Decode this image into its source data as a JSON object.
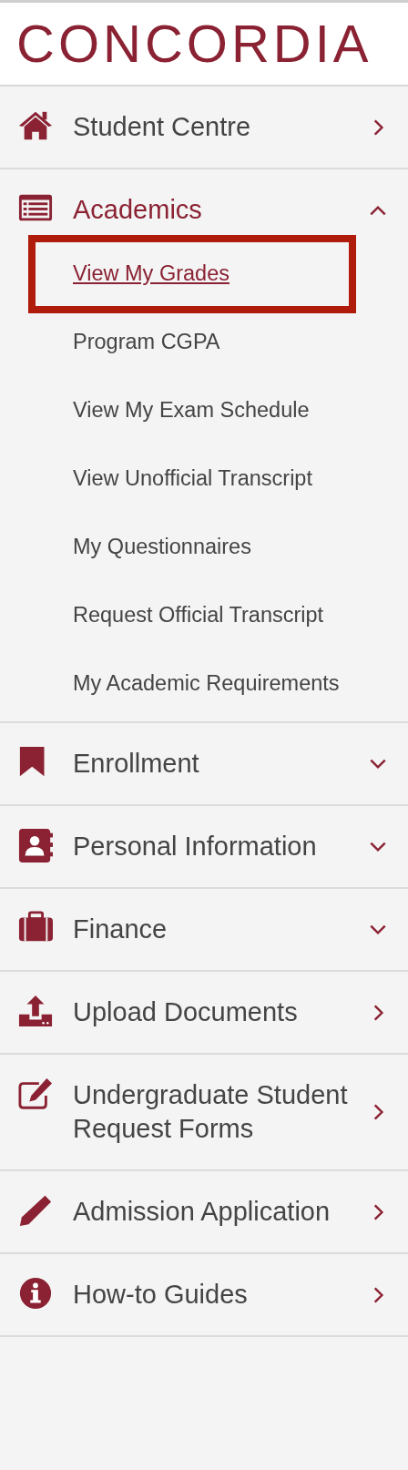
{
  "logo": {
    "text": "CONCORDIA"
  },
  "menu": [
    {
      "label": "Student Centre",
      "kind": "link"
    },
    {
      "label": "Academics",
      "kind": "group",
      "expanded": true,
      "children": [
        {
          "label": "View My Grades",
          "selected": true,
          "highlighted": true
        },
        {
          "label": "Program CGPA",
          "selected": false,
          "highlighted": false
        },
        {
          "label": "View My Exam Schedule",
          "selected": false,
          "highlighted": false
        },
        {
          "label": "View Unofficial Transcript",
          "selected": false,
          "highlighted": false
        },
        {
          "label": "My Questionnaires",
          "selected": false,
          "highlighted": false
        },
        {
          "label": "Request Official Transcript",
          "selected": false,
          "highlighted": false
        },
        {
          "label": "My Academic Requirements",
          "selected": false,
          "highlighted": false
        }
      ]
    },
    {
      "label": "Enrollment",
      "kind": "group",
      "expanded": false
    },
    {
      "label": "Personal Information",
      "kind": "group",
      "expanded": false
    },
    {
      "label": "Finance",
      "kind": "group",
      "expanded": false
    },
    {
      "label": "Upload Documents",
      "kind": "link"
    },
    {
      "label": "Undergraduate Student Request Forms",
      "kind": "link"
    },
    {
      "label": "Admission Application",
      "kind": "link"
    },
    {
      "label": "How-to Guides",
      "kind": "link"
    }
  ]
}
